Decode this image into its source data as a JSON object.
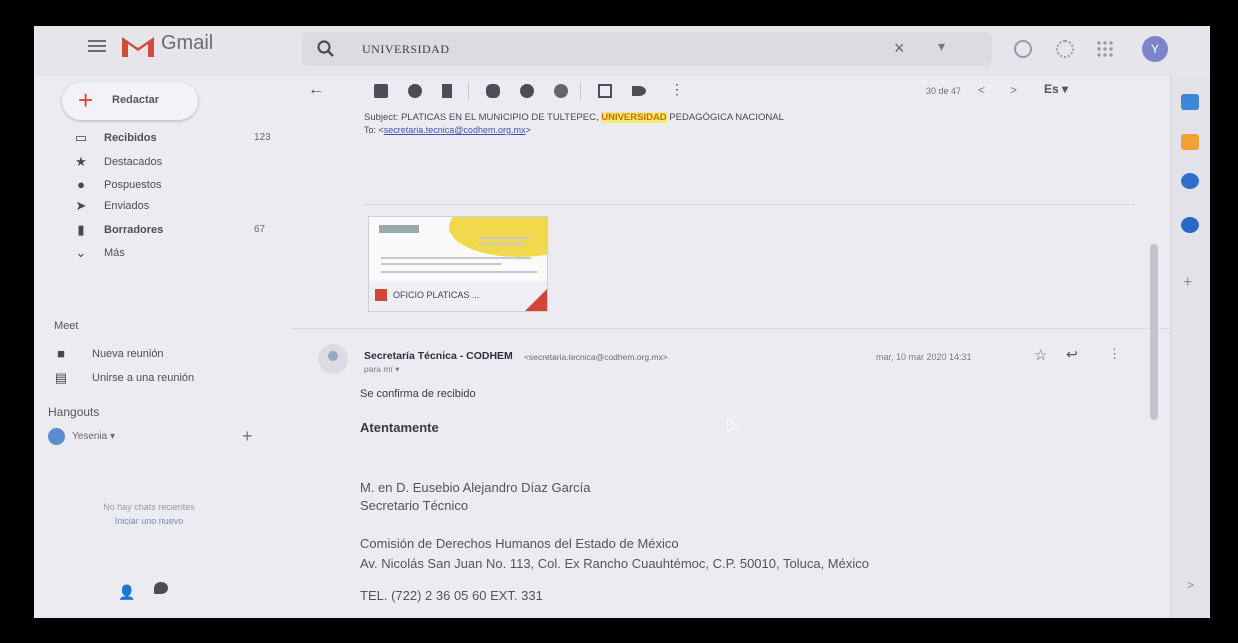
{
  "header": {
    "brand": "Gmail",
    "search_value": "UNIVERSIDAD",
    "search_clear": "×",
    "search_options": "▾",
    "account_initial": "Y"
  },
  "sidebar": {
    "compose_label": "Redactar",
    "items": [
      {
        "label": "Recibidos",
        "count": "123"
      },
      {
        "label": "Destacados",
        "count": ""
      },
      {
        "label": "Pospuestos",
        "count": ""
      },
      {
        "label": "Enviados",
        "count": ""
      },
      {
        "label": "Borradores",
        "count": "67"
      },
      {
        "label": "Más",
        "count": ""
      }
    ],
    "meet": {
      "title": "Meet",
      "new_meeting": "Nueva reunión",
      "join_meeting": "Unirse a una reunión"
    },
    "hangouts": {
      "title": "Hangouts",
      "user": "Yesenia",
      "user_caret": "▾",
      "add": "+",
      "no_chats": "No hay chats recientes",
      "start_new": "Iniciar uno nuevo"
    }
  },
  "toolbar": {
    "back": "←",
    "more": "⋮",
    "pager": "30 de 47",
    "prev": "<",
    "next": ">",
    "language": "Es ▾"
  },
  "quoted": {
    "subject_prefix": "Subject: PLATICAS EN EL MUNICIPIO DE TULTEPEC, ",
    "subject_highlight": "UNIVERSIDAD",
    "subject_suffix": " PEDAGÓGICA NACIONAL",
    "to_label": "To: <",
    "to_email": "secretaria.tecnica@codhem.org.mx",
    "to_close": ">"
  },
  "attachment": {
    "name": "OFICIO PLATICAS ..."
  },
  "message": {
    "sender_name": "Secretaría Técnica - CODHEM",
    "sender_email": "<secretaria.tecnica@codhem.org.mx>",
    "recipient": "para mí ▾",
    "date": "mar, 10 mar 2020 14:31",
    "star": "☆",
    "reply": "↩",
    "more": "⋮",
    "body": {
      "confirm": "Se confirma de recibido",
      "regards": "Atentamente",
      "signer": "M. en D. Eusebio Alejandro Díaz García",
      "role": "Secretario Técnico",
      "organization": "Comisión de Derechos Humanos del Estado de México",
      "address": "Av. Nicolás San Juan No. 113, Col. Ex Rancho Cuauhtémoc, C.P. 50010, Toluca, México",
      "phone": "TEL. (722) 2 36 05 60 EXT. 331"
    }
  },
  "sidepanel": {
    "add": "+",
    "expand": ">"
  },
  "colors": {
    "gmail_red": "#d24c3c",
    "highlight": "#f2ec70",
    "link": "#3f51b5"
  }
}
